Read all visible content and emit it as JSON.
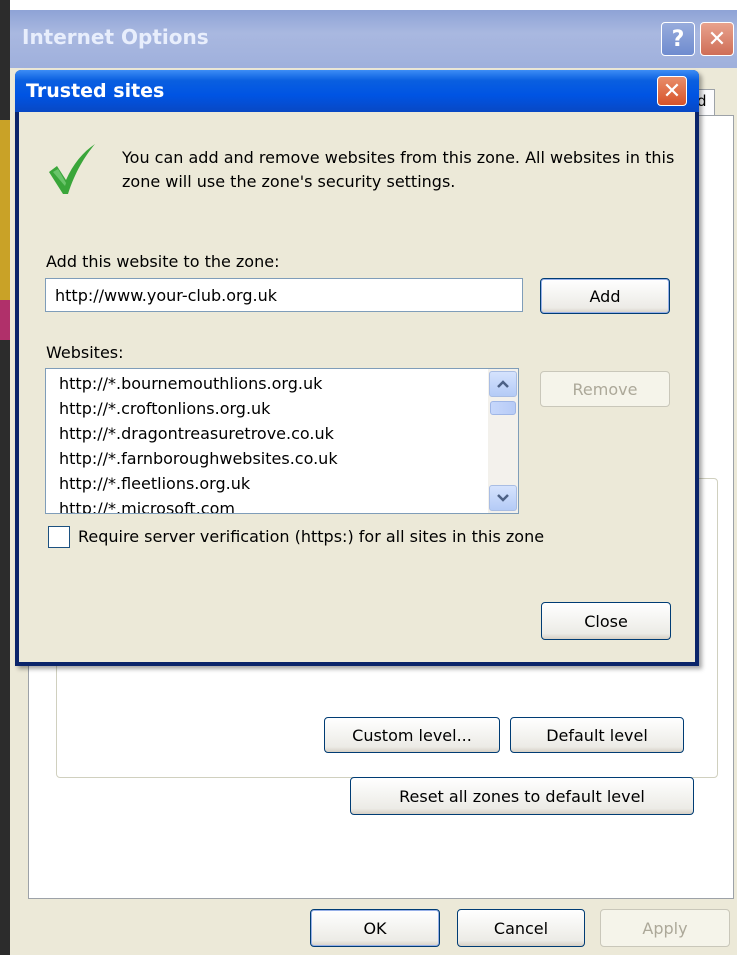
{
  "outer_window": {
    "title": "Internet Options",
    "help_glyph": "?",
    "close_glyph": "✕",
    "tab_peek_label": "d",
    "buttons": {
      "custom_level": "Custom level...",
      "default_level": "Default level",
      "reset_all": "Reset all zones to default level",
      "ok": "OK",
      "cancel": "Cancel",
      "apply": "Apply"
    }
  },
  "dialog": {
    "title": "Trusted sites",
    "close_glyph": "✕",
    "info_text": "You can add and remove websites from this zone. All websites in this zone will use the zone's security settings.",
    "add_label": "Add this website to the zone:",
    "add_input_value": "http://www.your-club.org.uk",
    "add_button": "Add",
    "websites_label": "Websites:",
    "websites": [
      "http://*.bournemouthlions.org.uk",
      "http://*.croftonlions.org.uk",
      "http://*.dragontreasuretrove.co.uk",
      "http://*.farnboroughwebsites.co.uk",
      "http://*.fleetlions.org.uk",
      "http://*.microsoft.com"
    ],
    "remove_button": "Remove",
    "require_https_label": "Require server verification (https:) for all sites in this zone",
    "require_https_checked": false,
    "close_button": "Close"
  },
  "colors": {
    "dialog_title": "#0054e3",
    "dialog_face": "#ece9d8",
    "close_red": "#d7532a",
    "check_green": "#3aa63a"
  },
  "icons": {
    "info": "checkmark-icon",
    "scroll_up": "chevron-up-icon",
    "scroll_down": "chevron-down-icon"
  }
}
